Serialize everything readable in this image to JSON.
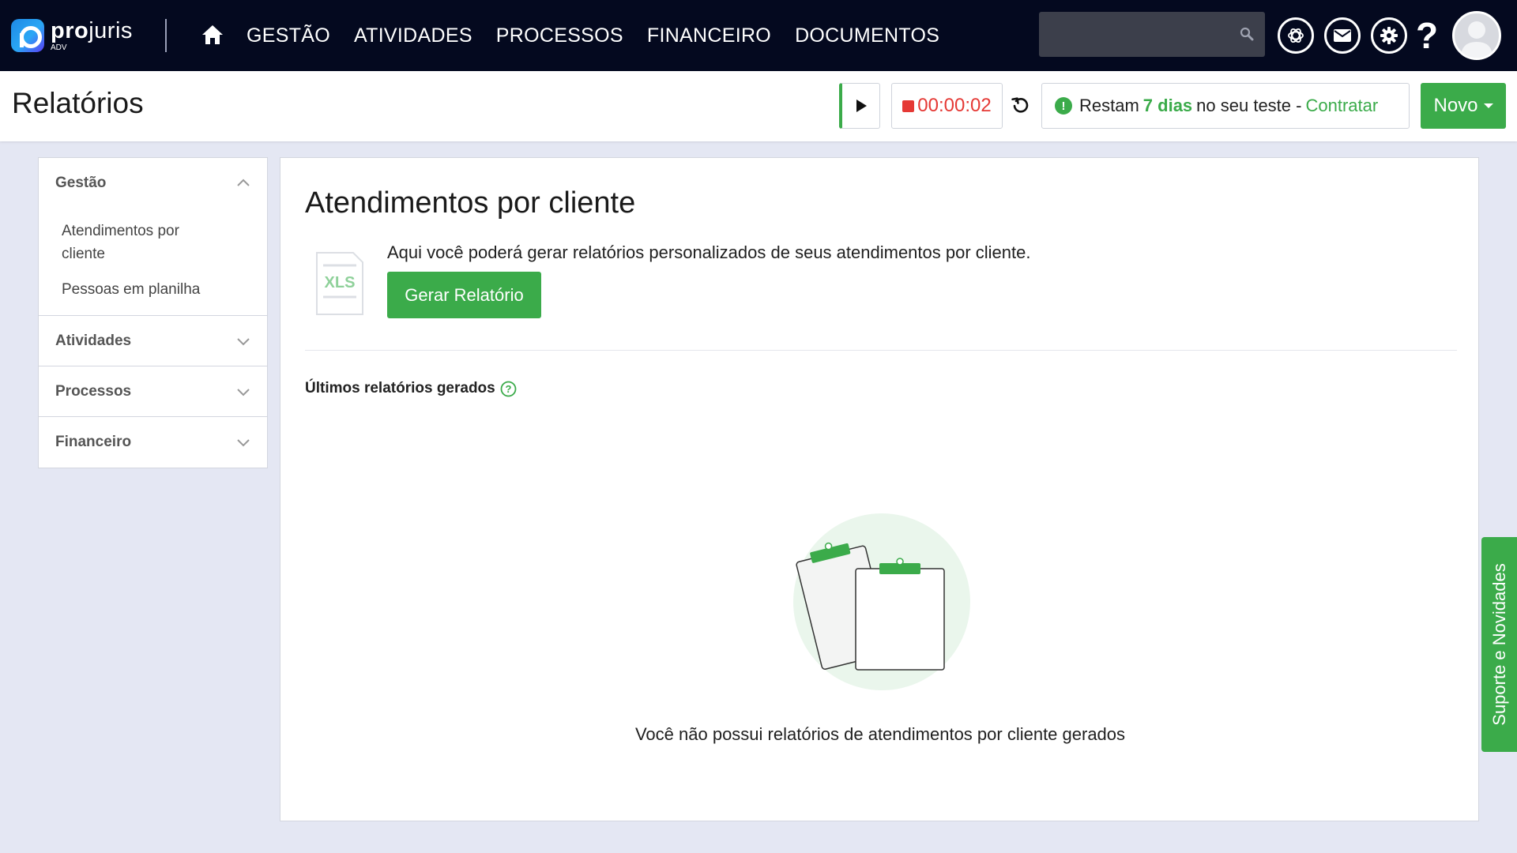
{
  "brand": {
    "name_bold": "pro",
    "name_light": "juris",
    "sub": "ADV"
  },
  "nav": {
    "items": [
      "GESTÃO",
      "ATIVIDADES",
      "PROCESSOS",
      "FINANCEIRO",
      "DOCUMENTOS"
    ],
    "search_placeholder": "",
    "help": "?"
  },
  "header": {
    "title": "Relatórios",
    "timer": "00:00:02",
    "trial_prefix": "Restam",
    "trial_days": "7 dias",
    "trial_suffix": "no seu teste -",
    "trial_link": "Contratar",
    "new_button": "Novo"
  },
  "sidebar": {
    "sections": [
      {
        "label": "Gestão",
        "open": true,
        "items": [
          "Atendimentos por cliente",
          "Pessoas em planilha"
        ]
      },
      {
        "label": "Atividades",
        "open": false
      },
      {
        "label": "Processos",
        "open": false
      },
      {
        "label": "Financeiro",
        "open": false
      }
    ]
  },
  "main": {
    "title": "Atendimentos por cliente",
    "xls_label": "XLS",
    "description": "Aqui você poderá gerar relatórios personalizados de seus atendimentos por cliente.",
    "generate_button": "Gerar Relatório",
    "last_reports_title": "Últimos relatórios gerados",
    "empty_message": "Você não possui relatórios de atendimentos por cliente gerados"
  },
  "support_tab": "Suporte e Novidades",
  "colors": {
    "nav_bg": "#04091f",
    "accent_green": "#3bab4a",
    "timer_red": "#e53935",
    "page_bg": "#e4e7f3"
  }
}
